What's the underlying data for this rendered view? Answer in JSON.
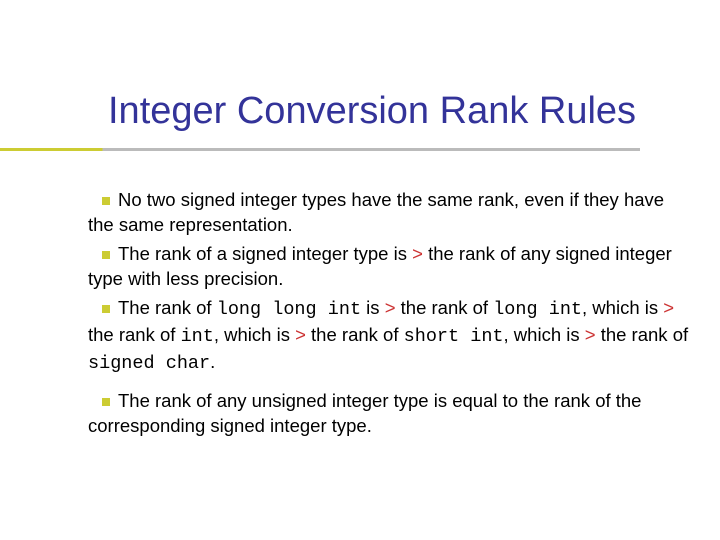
{
  "title": "Integer Conversion Rank Rules",
  "bullet_glyph": "square",
  "bullets": {
    "b1": "No two signed integer types have the same rank, even if they have the same representation.",
    "b2_a": "The rank of a signed integer type is ",
    "b2_gt": ">",
    "b2_b": " the rank of any signed integer type with less precision.",
    "b3_a": "The rank of ",
    "b3_c1": "long long int",
    "b3_b": " is ",
    "b3_gt1": ">",
    "b3_c": " the rank of ",
    "b3_c2": "long int",
    "b3_d": ", which is ",
    "b3_gt2": ">",
    "b3_e": " the rank of ",
    "b3_c3": "int",
    "b3_f": ", which is ",
    "b3_gt3": ">",
    "b3_g": " the rank of ",
    "b3_c4": "short int",
    "b3_h": ", which is ",
    "b3_gt4": ">",
    "b3_i": " the rank of ",
    "b3_c5": "signed char",
    "b3_j": ".",
    "b4": "The rank of any unsigned integer type is equal to the rank of the corresponding signed integer type."
  },
  "colors": {
    "title": "#333399",
    "accent": "#cccc33",
    "gt": "#cc3333"
  }
}
